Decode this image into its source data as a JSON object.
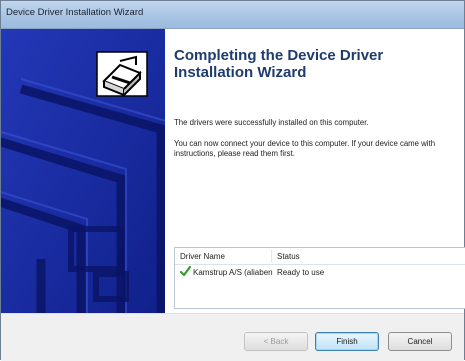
{
  "window": {
    "title": "Device Driver Installation Wizard"
  },
  "banner": {
    "icon": "driver-install-icon",
    "background_color": "#1b2fa3"
  },
  "main": {
    "heading": "Completing the Device Driver Installation Wizard",
    "paragraph1": "The drivers were successfully installed on this computer.",
    "paragraph2": "You can now connect your device to this computer. If your device came with instructions, please read them first."
  },
  "driver_list": {
    "columns": [
      "Driver Name",
      "Status"
    ],
    "rows": [
      {
        "icon": "check-icon",
        "name": "Kamstrup A/S (aliabenn)...",
        "status": "Ready to use"
      }
    ]
  },
  "buttons": {
    "back": "< Back",
    "finish": "Finish",
    "cancel": "Cancel"
  }
}
